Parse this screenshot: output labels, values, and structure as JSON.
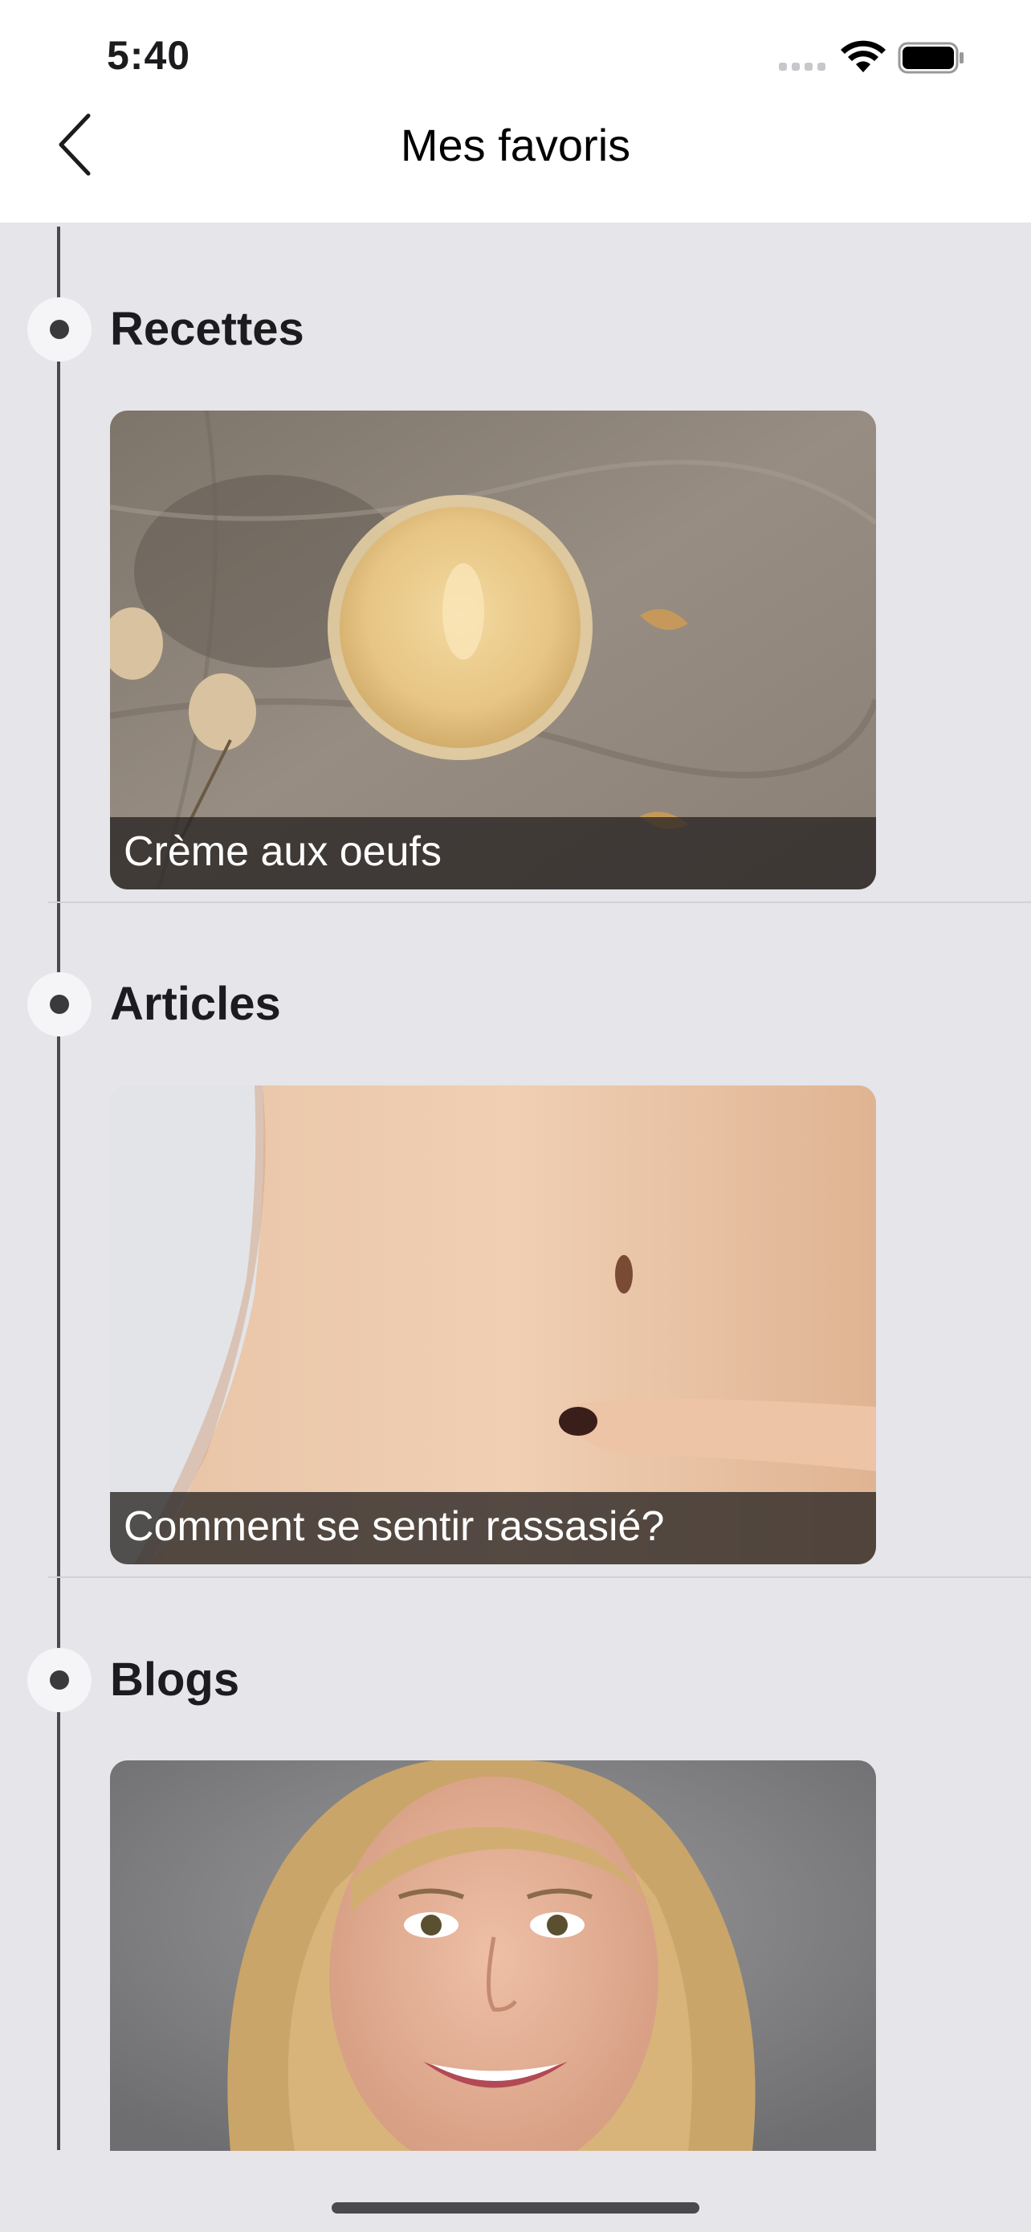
{
  "status": {
    "time": "5:40"
  },
  "nav": {
    "title": "Mes favoris"
  },
  "sections": [
    {
      "title": "Recettes",
      "card": {
        "caption": "Crème aux oeufs"
      }
    },
    {
      "title": "Articles",
      "card": {
        "caption": "Comment se sentir rassasié?"
      }
    },
    {
      "title": "Blogs",
      "card": {
        "caption": ""
      }
    }
  ],
  "colors": {
    "background": "#e5e5ea",
    "header": "#ffffff",
    "timeline": "#4a4a4c"
  }
}
